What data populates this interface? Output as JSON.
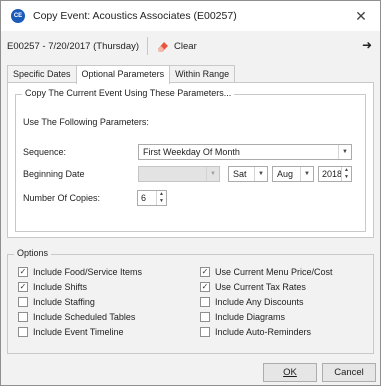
{
  "window": {
    "app_icon_text": "CE",
    "title": "Copy Event: Acoustics Associates (E00257)",
    "close_glyph": "✕"
  },
  "toolbar": {
    "event_info": "E00257 - 7/20/2017 (Thursday)",
    "clear_label": "Clear",
    "next_arrow": "➜"
  },
  "tabs": [
    {
      "label": "Specific Dates"
    },
    {
      "label": "Optional Parameters",
      "active": true
    },
    {
      "label": "Within Range"
    }
  ],
  "params": {
    "group_title": "Copy The Current Event Using These Parameters...",
    "use_label": "Use The Following Parameters:",
    "sequence_label": "Sequence:",
    "sequence_value": "First Weekday Of Month",
    "beginning_date_label": "Beginning Date",
    "beginning_date_value": "",
    "day_value": "Sat",
    "month_value": "Aug",
    "year_value": "2018",
    "copies_label": "Number Of Copies:",
    "copies_value": "6"
  },
  "options": {
    "group_title": "Options",
    "left": [
      {
        "label": "Include Food/Service Items",
        "checked": true
      },
      {
        "label": "Include Shifts",
        "checked": true
      },
      {
        "label": "Include Staffing",
        "checked": false
      },
      {
        "label": "Include Scheduled Tables",
        "checked": false
      },
      {
        "label": "Include Event Timeline",
        "checked": false
      }
    ],
    "right": [
      {
        "label": "Use Current Menu Price/Cost",
        "checked": true
      },
      {
        "label": "Use Current Tax Rates",
        "checked": true
      },
      {
        "label": "Include Any Discounts",
        "checked": false
      },
      {
        "label": "Include Diagrams",
        "checked": false
      },
      {
        "label": "Include Auto-Reminders",
        "checked": false
      }
    ]
  },
  "buttons": {
    "ok": "OK",
    "cancel": "Cancel"
  },
  "colors": {
    "app_icon": "#1a5bb8",
    "clear_icon": "#e8553d"
  },
  "icons": {
    "dropdown": "▼",
    "spin_up": "▲",
    "spin_down": "▼",
    "check": "✓"
  }
}
